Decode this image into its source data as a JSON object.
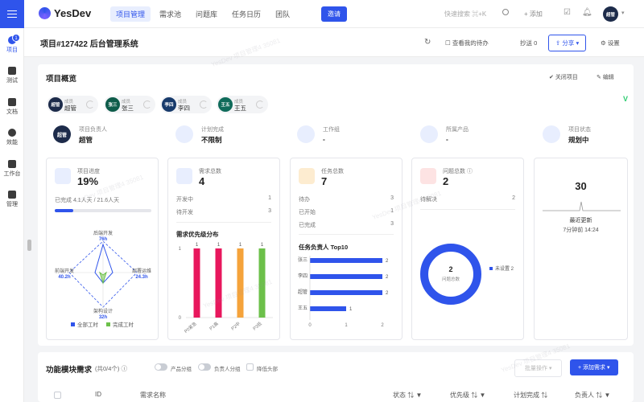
{
  "app": {
    "name": "YesDev"
  },
  "nav": [
    "项目管理",
    "需求池",
    "问题库",
    "任务日历",
    "团队"
  ],
  "invite": "邀请",
  "search": "快速搜索 ⌘+K",
  "add": "+ 添加",
  "user": {
    "avatar": "超管"
  },
  "sidebar": {
    "badge": "1",
    "items": [
      "项目",
      "测试",
      "文档",
      "效能",
      "工作台",
      "管理"
    ]
  },
  "header": {
    "title": "项目#127422 后台管理系统",
    "todo": "查看我的待办",
    "cc": "抄送 0",
    "share": "分享",
    "settings": "设置"
  },
  "overview": {
    "title": "项目概览",
    "close": "关闭项目",
    "edit": "编辑",
    "members": [
      {
        "avatar": "超管",
        "role": "成员",
        "name": "超管"
      },
      {
        "avatar": "张三",
        "role": "成员",
        "name": "张三"
      },
      {
        "avatar": "李四",
        "role": "成员",
        "name": "李四"
      },
      {
        "avatar": "王五",
        "role": "成员",
        "name": "王五"
      }
    ],
    "info": [
      {
        "label": "项目负责人",
        "value": "超管"
      },
      {
        "label": "计划完成",
        "value": "不限制"
      },
      {
        "label": "工作组",
        "value": "-"
      },
      {
        "label": "所属产品",
        "value": "-"
      },
      {
        "label": "项目状态",
        "value": "规划中"
      }
    ]
  },
  "progress": {
    "label": "项目进度",
    "value": "19%",
    "percent": 19,
    "done": "已完成 4.1人天 / 21.6人天"
  },
  "radar": {
    "axes": [
      {
        "name": "后端开发",
        "value": "76h"
      },
      {
        "name": "部署运维",
        "value": "24.3h"
      },
      {
        "name": "架构设计",
        "value": "32h"
      },
      {
        "name": "前端开发",
        "value": "40.2h"
      }
    ],
    "legend": [
      "全部工时",
      "完成工时"
    ]
  },
  "requirements": {
    "label": "需求总数",
    "value": "4",
    "rows": [
      {
        "k": "开发中",
        "v": "1"
      },
      {
        "k": "待开发",
        "v": "3"
      }
    ],
    "chart_title": "需求优先级分布"
  },
  "tasks": {
    "label": "任务总数",
    "value": "7",
    "rows": [
      {
        "k": "待办",
        "v": "3"
      },
      {
        "k": "已开始",
        "v": "1"
      },
      {
        "k": "已完成",
        "v": "3"
      }
    ],
    "chart_title": "任务负责人 Top10"
  },
  "issues": {
    "label": "问题总数",
    "value": "2",
    "rows": [
      {
        "k": "待解决",
        "v": "2"
      }
    ],
    "donut_value": "2",
    "donut_label": "问题总数",
    "legend": "未设置 2"
  },
  "activity": {
    "value": "30",
    "label": "最近更新",
    "time": "7分钟前 14:24"
  },
  "chart_data": [
    {
      "type": "bar",
      "categories": [
        "P0紧急",
        "P1高",
        "P2中",
        "P3低"
      ],
      "values": [
        1,
        1,
        1,
        1
      ],
      "ylim": [
        0,
        1
      ],
      "colors": [
        "#e8175d",
        "#e8175d",
        "#f5a33b",
        "#6cc04a"
      ]
    },
    {
      "type": "bar",
      "orientation": "horizontal",
      "categories": [
        "张三",
        "李四",
        "超管",
        "王五"
      ],
      "values": [
        2,
        2,
        2,
        1
      ],
      "xlim": [
        0,
        2
      ],
      "xticks": [
        "0",
        "1",
        "2"
      ]
    },
    {
      "type": "pie",
      "categories": [
        "未设置"
      ],
      "values": [
        2
      ]
    }
  ],
  "bottom": {
    "title": "功能模块需求",
    "count": "(共0/4个)",
    "toggles": [
      "产品分组",
      "负责人分组"
    ],
    "check": "降低头部",
    "batch": "批量操作",
    "add": "+ 添加需求",
    "columns": [
      "ID",
      "需求名称",
      "状态",
      "优先级",
      "计划完成",
      "负责人"
    ]
  },
  "watermark": "YesDev 项目管理4 35081"
}
